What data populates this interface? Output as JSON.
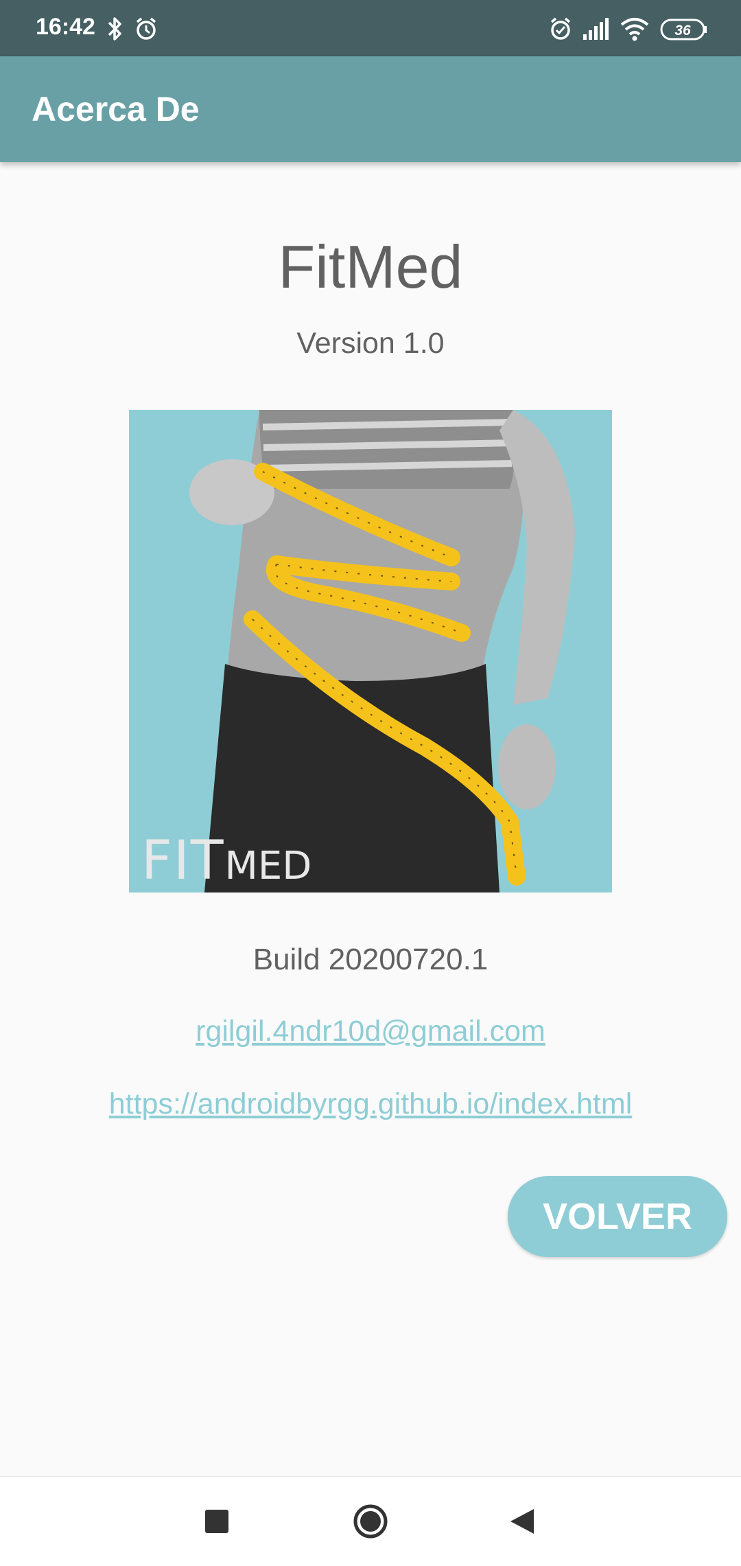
{
  "status_bar": {
    "time": "16:42",
    "battery": "36",
    "icons": [
      "bluetooth-icon",
      "alarm-icon",
      "alarm-icon",
      "signal-icon",
      "wifi-icon",
      "battery-icon"
    ]
  },
  "app_bar": {
    "title": "Acerca De"
  },
  "about": {
    "app_name": "FitMed",
    "version": "Version 1.0",
    "logo": {
      "text_fit": "FIT",
      "text_med": "MED"
    },
    "build": "Build 20200720.1",
    "email": "rgilgil.4ndr10d@gmail.com",
    "website": "https://androidbyrgg.github.io/index.html",
    "back_button": "VOLVER"
  },
  "colors": {
    "status_bar": "#455f63",
    "app_bar": "#68a0a5",
    "accent": "#8ecdd5",
    "text": "#616161",
    "background": "#fafafa"
  },
  "nav_bar": {
    "icons": [
      "recents-icon",
      "home-icon",
      "back-icon"
    ]
  }
}
